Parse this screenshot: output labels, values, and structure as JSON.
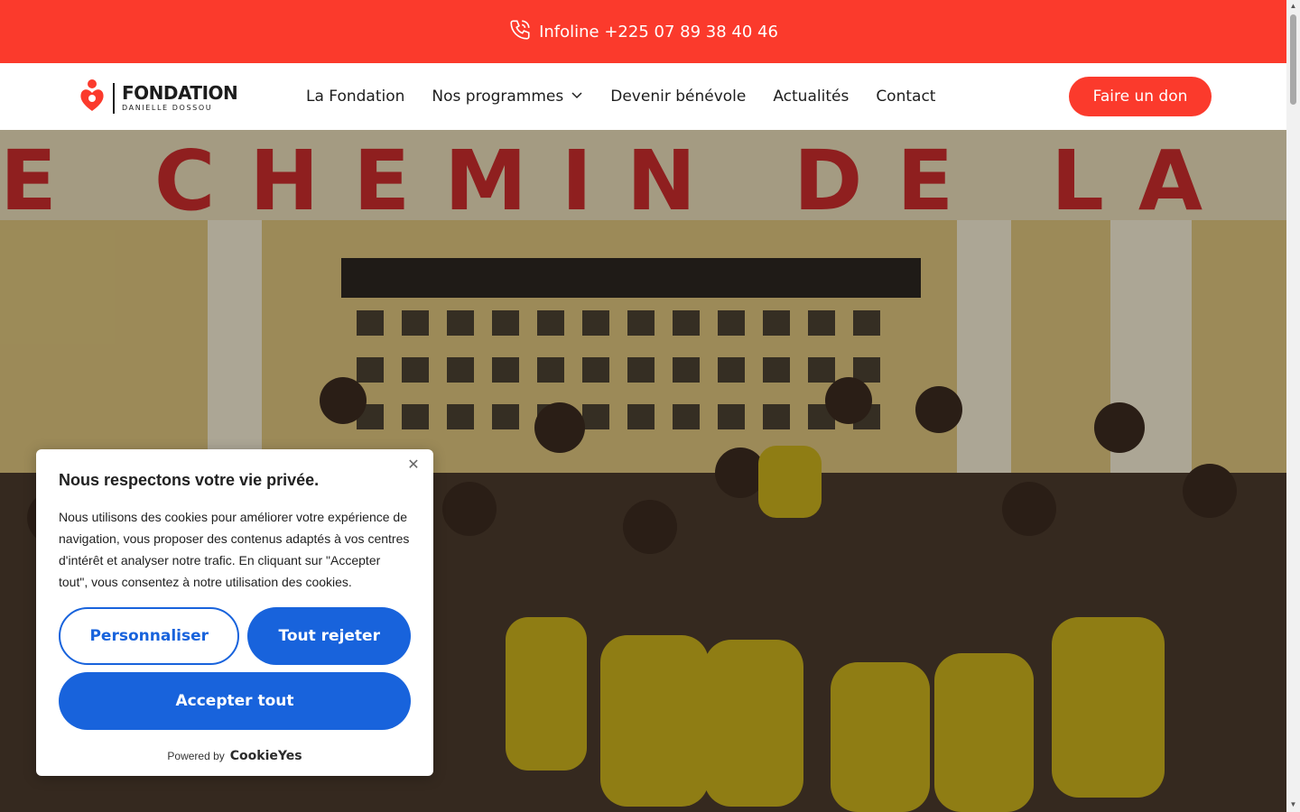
{
  "topbar": {
    "infoline": "Infoline +225 07 89 38 40 46",
    "icon": "phone-icon"
  },
  "logo": {
    "line1": "FONDATION",
    "line2": "DANIELLE DOSSOU"
  },
  "nav": {
    "items": [
      {
        "label": "La Fondation"
      },
      {
        "label": "Nos programmes",
        "has_dropdown": true
      },
      {
        "label": "Devenir bénévole"
      },
      {
        "label": "Actualités"
      },
      {
        "label": "Contact"
      }
    ],
    "donate_label": "Faire un don"
  },
  "hero": {
    "wall_text": "E CHEMIN DE LA REUSS"
  },
  "cookie": {
    "title": "Nous respectons votre vie privée.",
    "body": "Nous utilisons des cookies pour améliorer votre expérience de navigation, vous proposer des contenus adaptés à vos centres d'intérêt et analyser notre trafic. En cliquant sur \"Accepter tout\", vous consentez à notre utilisation des cookies.",
    "customize_label": "Personnaliser",
    "reject_label": "Tout rejeter",
    "accept_label": "Accepter tout",
    "powered_by": "Powered by",
    "powered_brand": "CookieYes"
  },
  "colors": {
    "brand_red": "#fb3a2c",
    "cookie_blue": "#1863dc"
  }
}
